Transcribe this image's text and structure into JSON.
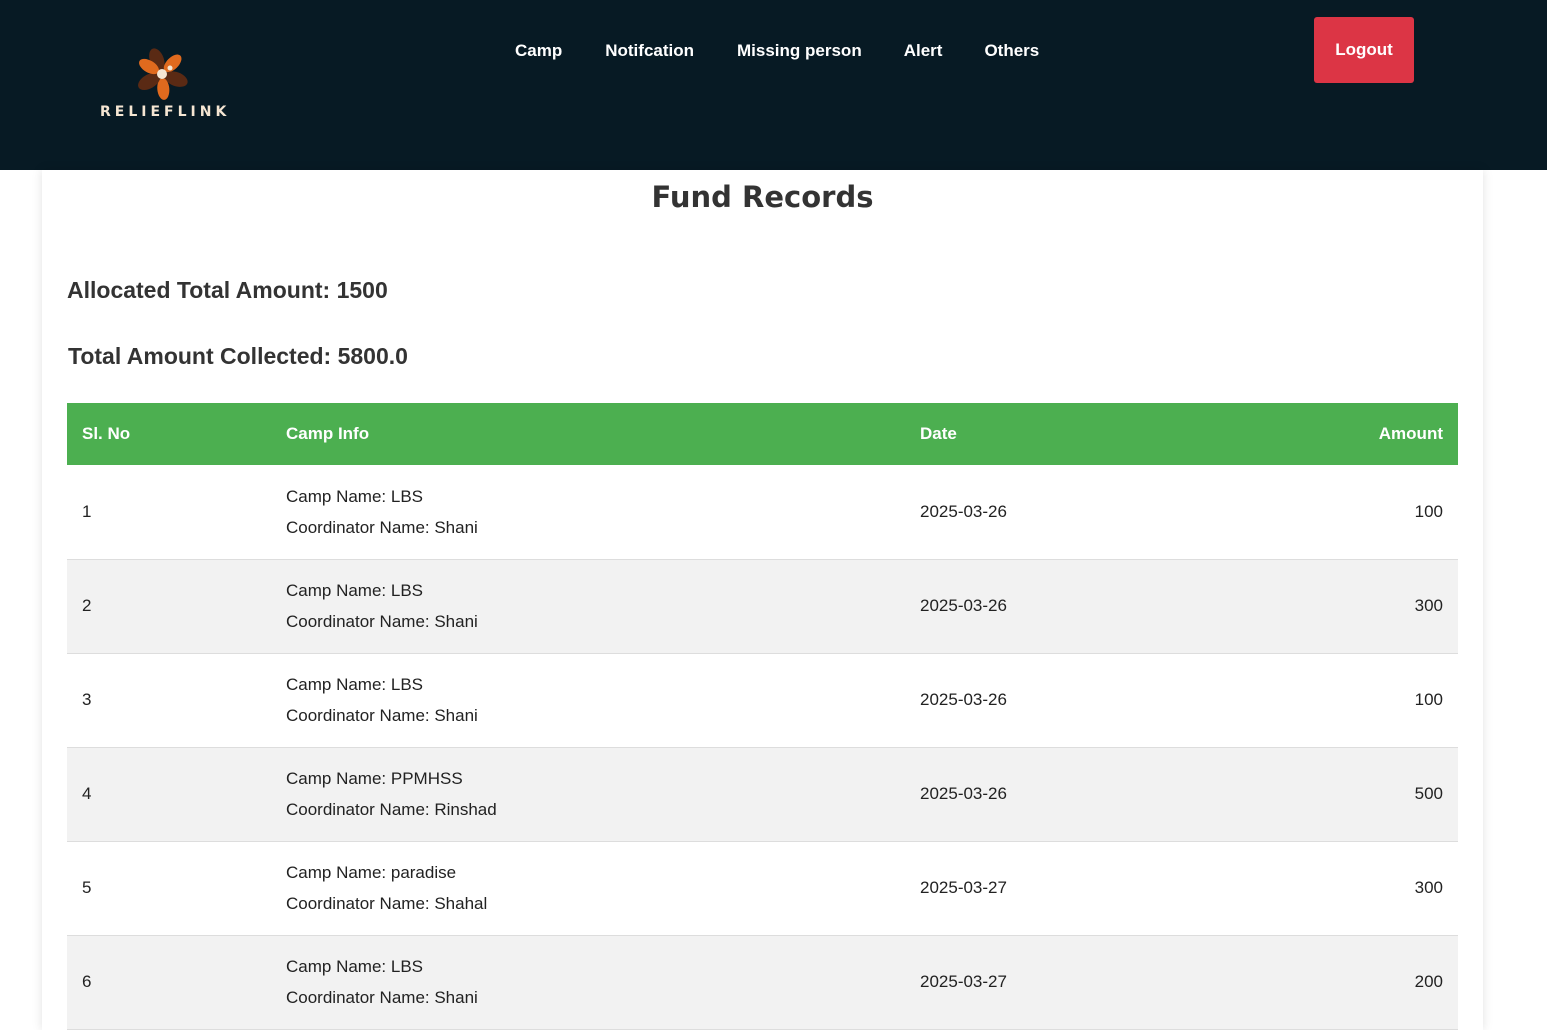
{
  "brand": {
    "name": "RELIEFLINK",
    "colors": {
      "petal_dark": "#5a2a14",
      "petal_orange": "#e06a1e",
      "petal_light": "#f5e6d3"
    }
  },
  "nav": {
    "items": [
      {
        "label": "Camp"
      },
      {
        "label": "Notifcation"
      },
      {
        "label": "Missing person"
      },
      {
        "label": "Alert"
      },
      {
        "label": "Others"
      }
    ],
    "logout_label": "Logout"
  },
  "colors": {
    "navbar_bg": "#071a24",
    "logout_bg": "#dc3545",
    "table_header_bg": "#4caf50"
  },
  "page": {
    "title": "Fund Records",
    "allocated_label": "Allocated Total Amount: 1500",
    "collected_label": "Total Amount Collected: 5800.0"
  },
  "table": {
    "headers": {
      "slno": "Sl. No",
      "info": "Camp Info",
      "date": "Date",
      "amount": "Amount"
    },
    "rows": [
      {
        "slno": "1",
        "camp": "Camp Name: LBS",
        "coordinator": "Coordinator Name: Shani",
        "date": "2025-03-26",
        "amount": "100"
      },
      {
        "slno": "2",
        "camp": "Camp Name: LBS",
        "coordinator": "Coordinator Name: Shani",
        "date": "2025-03-26",
        "amount": "300"
      },
      {
        "slno": "3",
        "camp": "Camp Name: LBS",
        "coordinator": "Coordinator Name: Shani",
        "date": "2025-03-26",
        "amount": "100"
      },
      {
        "slno": "4",
        "camp": "Camp Name: PPMHSS",
        "coordinator": "Coordinator Name: Rinshad",
        "date": "2025-03-26",
        "amount": "500"
      },
      {
        "slno": "5",
        "camp": "Camp Name: paradise",
        "coordinator": "Coordinator Name: Shahal",
        "date": "2025-03-27",
        "amount": "300"
      },
      {
        "slno": "6",
        "camp": "Camp Name: LBS",
        "coordinator": "Coordinator Name: Shani",
        "date": "2025-03-27",
        "amount": "200"
      }
    ]
  }
}
